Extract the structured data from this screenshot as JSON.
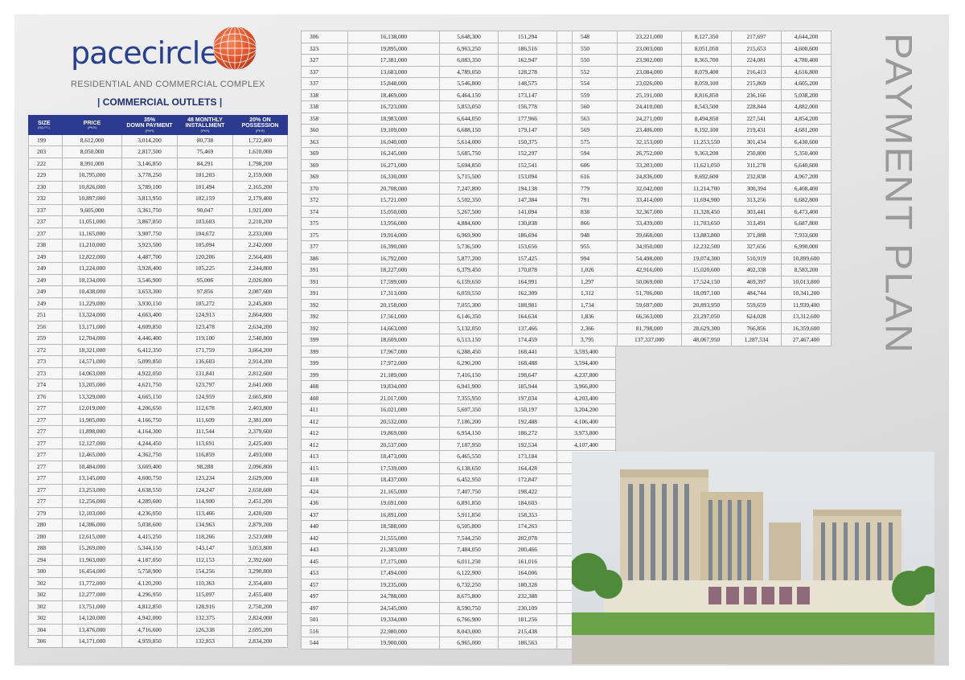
{
  "brand": {
    "name": "pacecircle",
    "tagline": "RESIDENTIAL AND COMMERCIAL COMPLEX",
    "section": "COMMERCIAL OUTLETS",
    "globe_color": "#e2542a"
  },
  "title": "PAYMENT PLAN",
  "colors": {
    "header": "#2b3a8f",
    "brand": "#283f8c",
    "title": "#9a9a9a"
  },
  "table_headers": {
    "size": "SIZE",
    "size_unit": "(SQ.FT.)",
    "price": "PRICE",
    "price_unit": "(PKR)",
    "down_pct": "35%",
    "down": "DOWN PAYMENT",
    "down_unit": "(PKR)",
    "monthly_pct": "48 MONTHLY",
    "monthly": "INSTALLMENT",
    "monthly_unit": "(PKR)",
    "poss_pct": "20% ON",
    "poss": "POSSESSION",
    "poss_unit": "(PKR)"
  },
  "table1": [
    [
      "199",
      "8,612,000",
      "3,014,200",
      "80,738",
      "1,722,400"
    ],
    [
      "203",
      "8,050,000",
      "2,817,500",
      "75,469",
      "1,610,000"
    ],
    [
      "222",
      "8,991,000",
      "3,146,850",
      "84,291",
      "1,798,200"
    ],
    [
      "229",
      "10,795,000",
      "3,778,250",
      "101,203",
      "2,159,000"
    ],
    [
      "230",
      "10,826,000",
      "3,789,100",
      "101,494",
      "2,165,200"
    ],
    [
      "232",
      "10,897,000",
      "3,813,950",
      "102,159",
      "2,179,400"
    ],
    [
      "237",
      "9,605,000",
      "3,361,750",
      "90,047",
      "1,921,000"
    ],
    [
      "237",
      "11,051,000",
      "3,867,850",
      "103,603",
      "2,210,200"
    ],
    [
      "237",
      "11,165,000",
      "3,907,750",
      "104,672",
      "2,233,000"
    ],
    [
      "238",
      "11,210,000",
      "3,923,500",
      "105,094",
      "2,242,000"
    ],
    [
      "249",
      "12,822,000",
      "4,487,700",
      "120,206",
      "2,564,400"
    ],
    [
      "249",
      "11,224,000",
      "3,928,400",
      "105,225",
      "2,244,800"
    ],
    [
      "249",
      "10,134,000",
      "3,546,900",
      "95,006",
      "2,026,800"
    ],
    [
      "249",
      "10,438,000",
      "3,653,300",
      "97,856",
      "2,087,600"
    ],
    [
      "249",
      "11,229,000",
      "3,930,150",
      "105,272",
      "2,245,800"
    ],
    [
      "251",
      "13,324,000",
      "4,663,400",
      "124,913",
      "2,664,800"
    ],
    [
      "256",
      "13,171,000",
      "4,609,850",
      "123,478",
      "2,634,200"
    ],
    [
      "259",
      "12,704,000",
      "4,446,400",
      "119,100",
      "2,540,800"
    ],
    [
      "272",
      "18,321,000",
      "6,412,350",
      "171,759",
      "3,664,200"
    ],
    [
      "273",
      "14,571,000",
      "5,099,850",
      "136,603",
      "2,914,200"
    ],
    [
      "273",
      "14,063,000",
      "4,922,050",
      "131,841",
      "2,812,600"
    ],
    [
      "274",
      "13,205,000",
      "4,621,750",
      "123,797",
      "2,641,000"
    ],
    [
      "276",
      "13,329,000",
      "4,665,150",
      "124,959",
      "2,665,800"
    ],
    [
      "277",
      "12,019,000",
      "4,206,650",
      "112,678",
      "2,403,800"
    ],
    [
      "277",
      "11,905,000",
      "4,166,750",
      "111,609",
      "2,381,000"
    ],
    [
      "277",
      "11,898,000",
      "4,164,300",
      "111,544",
      "2,379,600"
    ],
    [
      "277",
      "12,127,000",
      "4,244,450",
      "113,691",
      "2,425,400"
    ],
    [
      "277",
      "12,465,000",
      "4,362,750",
      "116,859",
      "2,493,000"
    ],
    [
      "277",
      "10,484,000",
      "3,669,400",
      "98,288",
      "2,096,800"
    ],
    [
      "277",
      "13,145,000",
      "4,600,750",
      "123,234",
      "2,629,000"
    ],
    [
      "277",
      "13,253,000",
      "4,638,550",
      "124,247",
      "2,650,600"
    ],
    [
      "277",
      "12,256,000",
      "4,289,600",
      "114,900",
      "2,451,200"
    ],
    [
      "279",
      "12,103,000",
      "4,236,050",
      "113,466",
      "2,420,600"
    ],
    [
      "280",
      "14,396,000",
      "5,038,600",
      "134,963",
      "2,879,200"
    ],
    [
      "280",
      "12,615,000",
      "4,415,250",
      "118,266",
      "2,523,000"
    ],
    [
      "288",
      "15,269,000",
      "5,344,150",
      "143,147",
      "3,053,800"
    ],
    [
      "294",
      "11,963,000",
      "4,187,050",
      "112,153",
      "2,392,600"
    ],
    [
      "300",
      "16,454,000",
      "5,758,900",
      "154,256",
      "3,290,800"
    ],
    [
      "302",
      "11,772,000",
      "4,120,200",
      "110,363",
      "2,354,400"
    ],
    [
      "302",
      "12,277,000",
      "4,296,950",
      "115,097",
      "2,455,400"
    ],
    [
      "302",
      "13,751,000",
      "4,812,850",
      "128,916",
      "2,750,200"
    ],
    [
      "302",
      "14,120,000",
      "4,942,000",
      "132,375",
      "2,824,000"
    ],
    [
      "304",
      "13,476,000",
      "4,716,600",
      "126,338",
      "2,695,200"
    ],
    [
      "306",
      "14,171,000",
      "4,959,850",
      "132,853",
      "2,834,200"
    ]
  ],
  "table2": [
    [
      "306",
      "16,138,000",
      "5,648,300",
      "151,294",
      "3,227,600"
    ],
    [
      "323",
      "19,895,000",
      "6,963,250",
      "186,516",
      "3,979,000"
    ],
    [
      "327",
      "17,381,000",
      "6,083,350",
      "162,947",
      "3,476,200"
    ],
    [
      "337",
      "13,683,000",
      "4,789,050",
      "128,278",
      "2,736,600"
    ],
    [
      "337",
      "15,848,000",
      "5,546,800",
      "148,575",
      "3,169,600"
    ],
    [
      "338",
      "18,469,000",
      "6,464,150",
      "173,147",
      "3,693,800"
    ],
    [
      "338",
      "16,723,000",
      "5,853,050",
      "156,778",
      "3,344,600"
    ],
    [
      "358",
      "18,983,000",
      "6,644,050",
      "177,966",
      "3,796,600"
    ],
    [
      "360",
      "19,109,000",
      "6,688,150",
      "179,147",
      "3,821,800"
    ],
    [
      "363",
      "16,040,000",
      "5,614,000",
      "150,375",
      "3,208,000"
    ],
    [
      "369",
      "16,245,000",
      "5,685,750",
      "152,297",
      "3,249,000"
    ],
    [
      "369",
      "16,271,000",
      "5,694,850",
      "152,541",
      "3,254,200"
    ],
    [
      "369",
      "16,330,000",
      "5,715,500",
      "153,094",
      "3,266,000"
    ],
    [
      "370",
      "20,708,000",
      "7,247,800",
      "194,138",
      "4,141,600"
    ],
    [
      "372",
      "15,721,000",
      "5,502,350",
      "147,384",
      "3,144,200"
    ],
    [
      "374",
      "15,050,000",
      "5,267,500",
      "141,094",
      "3,010,000"
    ],
    [
      "375",
      "13,956,000",
      "4,884,600",
      "130,838",
      "2,791,200"
    ],
    [
      "375",
      "19,914,000",
      "6,969,900",
      "186,694",
      "3,982,800"
    ],
    [
      "377",
      "16,390,000",
      "5,736,500",
      "153,656",
      "3,278,000"
    ],
    [
      "386",
      "16,792,000",
      "5,877,200",
      "157,425",
      "3,358,400"
    ],
    [
      "391",
      "18,227,000",
      "6,379,450",
      "170,878",
      "3,645,400"
    ],
    [
      "391",
      "17,599,000",
      "6,159,650",
      "164,991",
      "3,519,800"
    ],
    [
      "391",
      "17,313,000",
      "6,059,550",
      "162,309",
      "3,462,600"
    ],
    [
      "392",
      "20,158,000",
      "7,055,300",
      "188,981",
      "4,031,600"
    ],
    [
      "392",
      "17,561,000",
      "6,146,350",
      "164,634",
      "3,512,200"
    ],
    [
      "392",
      "14,663,000",
      "5,132,050",
      "137,466",
      "2,932,600"
    ],
    [
      "399",
      "18,609,000",
      "6,513,150",
      "174,459",
      "3,721,800"
    ],
    [
      "399",
      "17,967,000",
      "6,288,450",
      "168,441",
      "3,593,400"
    ],
    [
      "399",
      "17,972,000",
      "6,290,200",
      "168,488",
      "3,594,400"
    ],
    [
      "399",
      "21,189,000",
      "7,416,150",
      "198,647",
      "4,237,800"
    ],
    [
      "408",
      "19,834,000",
      "6,941,900",
      "185,944",
      "3,966,800"
    ],
    [
      "408",
      "21,017,000",
      "7,355,950",
      "197,034",
      "4,203,400"
    ],
    [
      "411",
      "16,021,000",
      "5,607,350",
      "150,197",
      "3,204,200"
    ],
    [
      "412",
      "20,532,000",
      "7,186,200",
      "192,488",
      "4,106,400"
    ],
    [
      "412",
      "19,869,000",
      "6,954,150",
      "186,272",
      "3,973,800"
    ],
    [
      "412",
      "20,537,000",
      "7,187,950",
      "192,534",
      "4,107,400"
    ],
    [
      "413",
      "18,473,000",
      "6,465,550",
      "173,184",
      "3,694,600"
    ],
    [
      "415",
      "17,539,000",
      "6,138,650",
      "164,428",
      "3,507,800"
    ],
    [
      "418",
      "18,437,000",
      "6,452,950",
      "172,847",
      "3,687,400"
    ],
    [
      "424",
      "21,165,000",
      "7,407,750",
      "198,422",
      "4,233,000"
    ],
    [
      "436",
      "19,691,000",
      "6,891,850",
      "184,603",
      "3,938,200"
    ],
    [
      "437",
      "16,891,000",
      "5,911,850",
      "158,353",
      "3,378,200"
    ],
    [
      "440",
      "18,588,000",
      "6,505,800",
      "174,263",
      "3,717,600"
    ],
    [
      "442",
      "21,555,000",
      "7,544,250",
      "202,078",
      "4,311,000"
    ],
    [
      "443",
      "21,383,000",
      "7,484,050",
      "200,466",
      "4,276,600"
    ],
    [
      "445",
      "17,175,000",
      "6,011,250",
      "161,016",
      "3,435,000"
    ],
    [
      "453",
      "17,494,000",
      "6,122,900",
      "164,006",
      "3,498,800"
    ],
    [
      "457",
      "19,235,000",
      "6,732,250",
      "180,328",
      "3,847,000"
    ],
    [
      "497",
      "24,788,000",
      "8,675,800",
      "232,388",
      "4,957,600"
    ],
    [
      "497",
      "24,545,000",
      "8,590,750",
      "230,109",
      "4,909,000"
    ],
    [
      "501",
      "19,334,000",
      "6,766,900",
      "181,256",
      "3,866,800"
    ],
    [
      "516",
      "22,980,000",
      "8,043,000",
      "215,438",
      "4,596,000"
    ],
    [
      "544",
      "19,900,000",
      "6,965,000",
      "186,563",
      "3,980,000"
    ]
  ],
  "table3": [
    [
      "548",
      "23,221,000",
      "8,127,350",
      "217,697",
      "4,644,200"
    ],
    [
      "550",
      "23,003,000",
      "8,051,050",
      "215,653",
      "4,600,600"
    ],
    [
      "550",
      "23,902,000",
      "8,365,700",
      "224,081",
      "4,780,400"
    ],
    [
      "552",
      "23,084,000",
      "8,079,400",
      "216,413",
      "4,616,800"
    ],
    [
      "554",
      "23,026,000",
      "8,059,100",
      "215,869",
      "4,605,200"
    ],
    [
      "559",
      "25,191,000",
      "8,816,850",
      "236,166",
      "5,038,200"
    ],
    [
      "560",
      "24,410,000",
      "8,543,500",
      "228,844",
      "4,882,000"
    ],
    [
      "563",
      "24,271,000",
      "8,494,850",
      "227,541",
      "4,854,200"
    ],
    [
      "569",
      "23,406,000",
      "8,192,100",
      "219,431",
      "4,681,200"
    ],
    [
      "575",
      "32,153,000",
      "11,253,550",
      "301,434",
      "6,430,600"
    ],
    [
      "594",
      "26,752,000",
      "9,363,200",
      "250,800",
      "5,350,400"
    ],
    [
      "606",
      "33,203,000",
      "11,621,050",
      "311,278",
      "6,640,600"
    ],
    [
      "616",
      "24,836,000",
      "8,692,600",
      "232,838",
      "4,967,200"
    ],
    [
      "779",
      "32,042,000",
      "11,214,700",
      "300,394",
      "6,408,400"
    ],
    [
      "791",
      "33,414,000",
      "11,694,900",
      "313,256",
      "6,682,800"
    ],
    [
      "838",
      "32,367,000",
      "11,328,450",
      "303,441",
      "6,473,400"
    ],
    [
      "866",
      "33,439,000",
      "11,703,650",
      "313,491",
      "6,687,800"
    ],
    [
      "948",
      "39,668,000",
      "13,883,800",
      "371,888",
      "7,933,600"
    ],
    [
      "955",
      "34,950,000",
      "12,232,500",
      "327,656",
      "6,990,000"
    ],
    [
      "994",
      "54,498,000",
      "19,074,300",
      "510,919",
      "10,899,600"
    ],
    [
      "1,026",
      "42,916,000",
      "15,020,600",
      "402,338",
      "8,583,200"
    ],
    [
      "1,297",
      "50,069,000",
      "17,524,150",
      "469,397",
      "10,013,800"
    ],
    [
      "1,312",
      "51,706,000",
      "18,097,100",
      "484,744",
      "10,341,200"
    ],
    [
      "1,734",
      "59,697,000",
      "20,893,950",
      "559,659",
      "11,939,400"
    ],
    [
      "1,836",
      "66,563,000",
      "23,297,050",
      "624,028",
      "13,312,600"
    ],
    [
      "2,366",
      "81,798,000",
      "28,629,300",
      "766,856",
      "16,359,600"
    ],
    [
      "3,795",
      "137,337,000",
      "48,067,950",
      "1,287,534",
      "27,467,400"
    ]
  ]
}
